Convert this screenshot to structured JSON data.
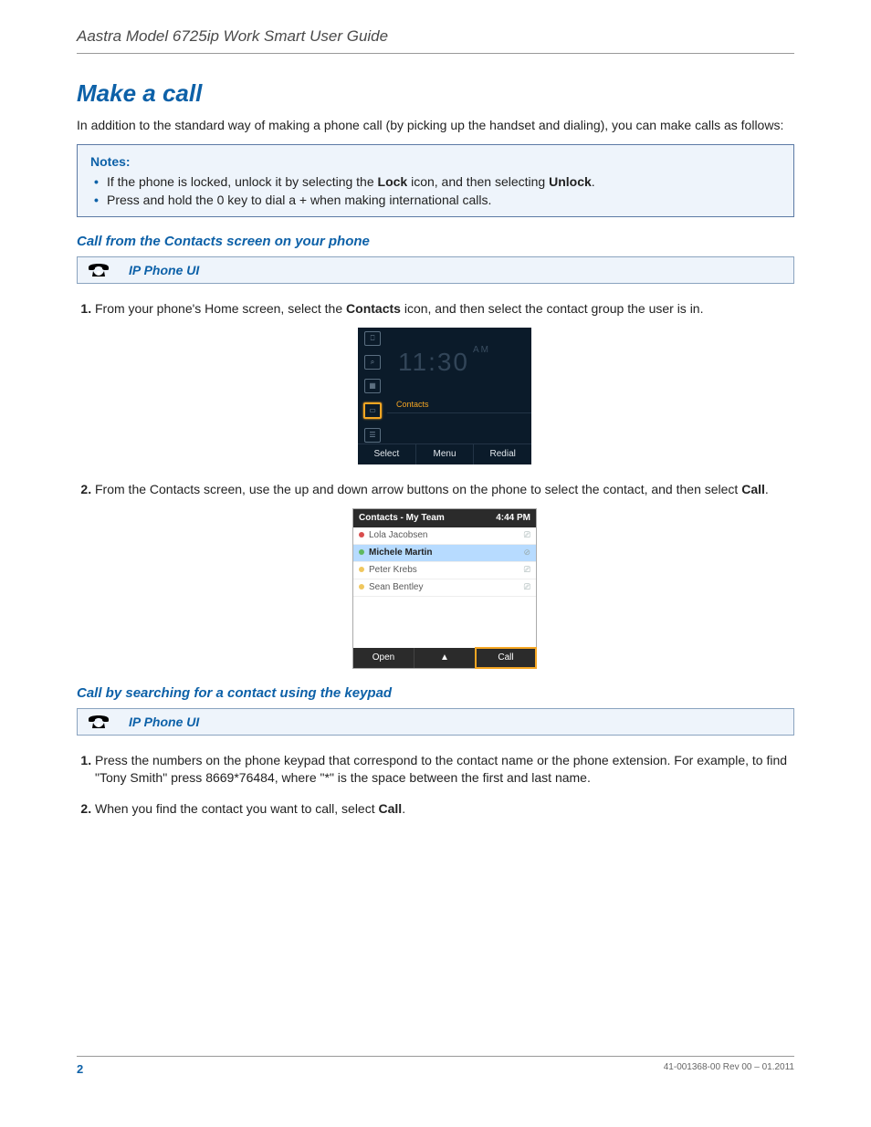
{
  "header": {
    "running_title": "Aastra Model 6725ip Work Smart User Guide"
  },
  "title": "Make a call",
  "intro": "In addition to the standard way of making a phone call (by picking up the handset and dialing), you can make calls as follows:",
  "notes": {
    "heading": "Notes:",
    "items": {
      "n1_pre": "If the phone is locked, unlock it by selecting the ",
      "n1_b1": "Lock",
      "n1_mid": " icon, and then selecting ",
      "n1_b2": "Unlock",
      "n1_post": ".",
      "n2": "Press and hold the 0 key to dial a + when making international calls."
    }
  },
  "sectionA": {
    "heading": "Call from the Contacts screen on your phone",
    "uibar": "IP Phone UI",
    "step1_pre": "From your phone's Home screen, select the ",
    "step1_b": "Contacts",
    "step1_post": " icon, and then select the contact group the user is in.",
    "step2_pre": "From the Contacts screen, use the up and down arrow buttons on the phone to select the contact, and then select ",
    "step2_b": "Call",
    "step2_post": "."
  },
  "phone1": {
    "time": "11:30",
    "ampm": "AM",
    "selected_label": "Contacts",
    "soft_left": "Select",
    "soft_mid": "Menu",
    "soft_right": "Redial"
  },
  "phone2": {
    "title": "Contacts - My Team",
    "clock": "4:44 PM",
    "rows": [
      {
        "name": "Lola Jacobsen",
        "color": "#d94e4e",
        "selected": false
      },
      {
        "name": "Michele Martin",
        "color": "#5fb85f",
        "selected": true
      },
      {
        "name": "Peter Krebs",
        "color": "#f0c75e",
        "selected": false
      },
      {
        "name": "Sean Bentley",
        "color": "#f0c75e",
        "selected": false
      }
    ],
    "soft_left": "Open",
    "soft_mid": "▲",
    "soft_right": "Call"
  },
  "sectionB": {
    "heading": "Call by searching for a contact using the keypad",
    "uibar": "IP Phone UI",
    "step1": "Press the numbers on the phone keypad that correspond to the contact name or the phone extension. For example, to find \"Tony Smith\" press 8669*76484, where \"*\" is the space between the first and last name.",
    "step2_pre": "When you find the contact you want to call, select ",
    "step2_b": "Call",
    "step2_post": "."
  },
  "footer": {
    "page": "2",
    "rev": "41-001368-00 Rev 00  –  01.2011"
  }
}
